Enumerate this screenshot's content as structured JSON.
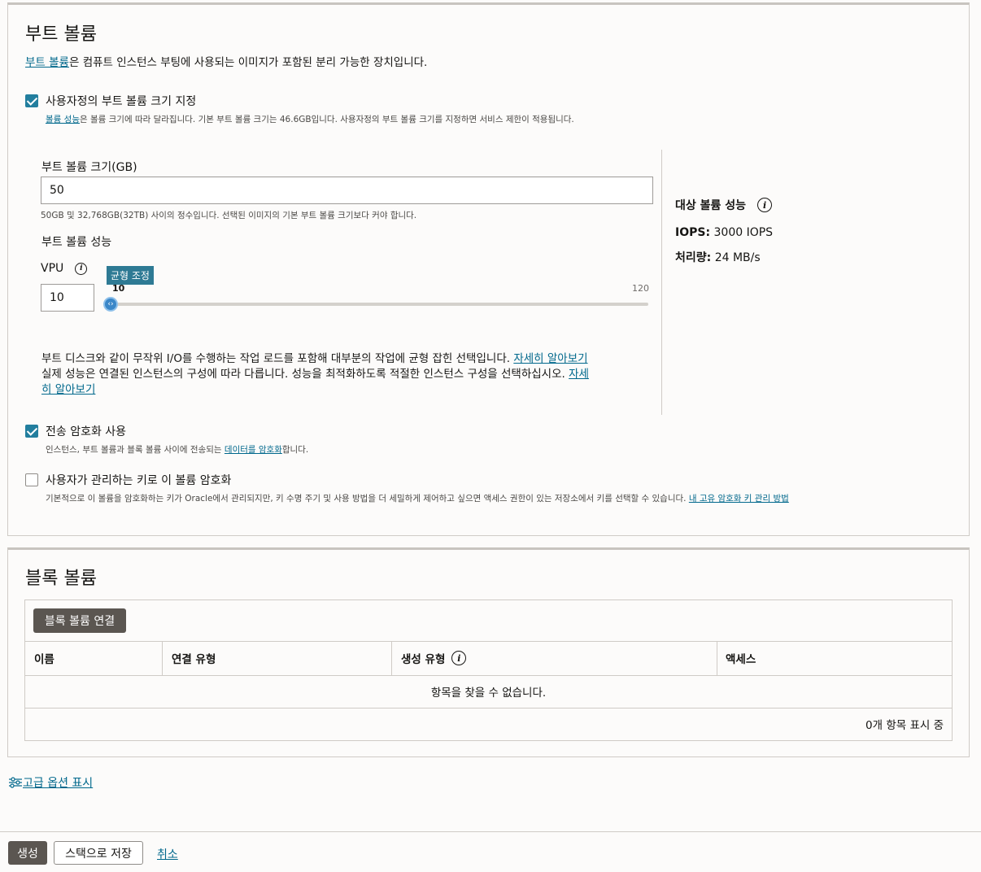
{
  "boot": {
    "title": "부트 볼륨",
    "intro_link": "부트 볼륨",
    "intro_rest": "은 컴퓨트 인스턴스 부팅에 사용되는 이미지가 포함된 분리 가능한 장치입니다.",
    "custom_size": {
      "checked": true,
      "label": "사용자정의 부트 볼륨 크기 지정",
      "help_link": "볼륨 성능",
      "help_rest": "은 볼륨 크기에 따라 달라집니다. 기본 부트 볼륨 크기는 46.6GB입니다. 사용자정의 부트 볼륨 크기를 지정하면 서비스 제한이 적용됩니다."
    },
    "size_label": "부트 볼륨 크기(GB)",
    "size_value": "50",
    "size_help": "50GB 및 32,768GB(32TB) 사이의 정수입니다. 선택된 이미지의 기본 부트 볼륨 크기보다 커야 합니다.",
    "perf_label": "부트 볼륨 성능",
    "vpu_label": "VPU",
    "vpu_value": "10",
    "slider": {
      "tooltip": "균형 조정",
      "min_label": "10",
      "max_label": "120",
      "value": 10,
      "min": 10,
      "max": 120
    },
    "perf_desc1": "부트 디스크와 같이 무작위 I/O를 수행하는 작업 로드를 포함해 대부분의 작업에 균형 잡힌 선택입니다. ",
    "perf_link1": "자세히 알아보기",
    "perf_desc2": "실제 성능은 연결된 인스턴스의 구성에 따라 다릅니다. 성능을 최적화하도록 적절한 인스턴스 구성을 선택하십시오. ",
    "perf_link2a": "자세",
    "perf_link2b": "히 알아보기",
    "target": {
      "title": "대상 볼륨 성능",
      "iops_label": "IOPS:",
      "iops_value": "3000 IOPS",
      "throughput_label": "처리량:",
      "throughput_value": "24 MB/s"
    },
    "transit": {
      "checked": true,
      "label": "전송 암호화 사용",
      "help_pre": "인스턴스, 부트 볼륨과 블록 볼륨 사이에 전송되는 ",
      "help_link": "데이터를 암호화",
      "help_post": "합니다."
    },
    "own_key": {
      "checked": false,
      "label": "사용자가 관리하는 키로 이 볼륨 암호화",
      "help": "기본적으로 이 볼륨을 암호화하는 키가 Oracle에서 관리되지만, 키 수명 주기 및 사용 방법을 더 세밀하게 제어하고 싶으면 액세스 권한이 있는 저장소에서 키를 선택할 수 있습니다. ",
      "help_link": "내 고유 암호화 키 관리 방법"
    }
  },
  "block": {
    "title": "블록 볼륨",
    "attach_button": "블록 볼륨 연결",
    "columns": [
      "이름",
      "연결 유형",
      "생성 유형",
      "액세스"
    ],
    "empty": "항목을 찾을 수 없습니다.",
    "count": "0개 항목 표시 중"
  },
  "advanced_link": "고급 옵션 표시",
  "footer": {
    "create": "생성",
    "save_stack": "스택으로 저장",
    "cancel": "취소"
  }
}
